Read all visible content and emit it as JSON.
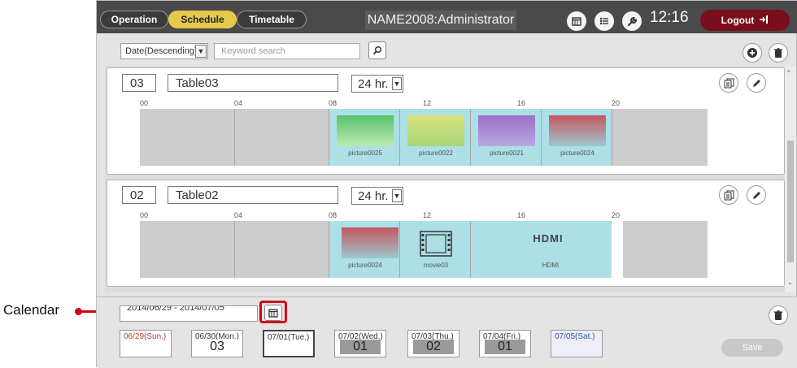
{
  "callout": {
    "label": "Calendar"
  },
  "nav": {
    "tabs": [
      {
        "label": "Operation",
        "active": false
      },
      {
        "label": "Schedule",
        "active": true
      },
      {
        "label": "Timetable",
        "active": false
      }
    ],
    "title": "NAME2008:Administrator",
    "icons": [
      "calendar-icon",
      "list-icon",
      "wrench-icon"
    ],
    "clock": "12:16",
    "logout_label": "Logout",
    "logout_icon": "logout-icon"
  },
  "toolbar": {
    "sort_value": "Date(Descending)",
    "search_placeholder": "Keyword search",
    "search_icon": "search-icon",
    "add_icon": "add-icon",
    "trash_icon": "trash-icon"
  },
  "tables": [
    {
      "number": "03",
      "name": "Table03",
      "hours": "24 hr.",
      "ticks": [
        "00",
        "04",
        "08",
        "12",
        "16",
        "20"
      ],
      "items": [
        {
          "caption": "picture0025",
          "color_top": "#58c26a",
          "color_bottom": "#bde8b4"
        },
        {
          "caption": "picture0022",
          "color_top": "#d8e27a",
          "color_bottom": "#a7d67a"
        },
        {
          "caption": "picture0021",
          "color_top": "#9b6fc9",
          "color_bottom": "#b9a7e0"
        },
        {
          "caption": "picture0024",
          "color_top": "#c4575f",
          "color_bottom": "#9fc7cf"
        }
      ]
    },
    {
      "number": "02",
      "name": "Table02",
      "hours": "24 hr.",
      "ticks": [
        "00",
        "04",
        "08",
        "12",
        "16",
        "20"
      ],
      "items": [
        {
          "caption": "picture0024",
          "color_top": "#c4575f",
          "color_bottom": "#9fc7cf"
        },
        {
          "caption": "movie03",
          "icon": "film-icon"
        },
        {
          "caption": "HDMI",
          "logo": "HDMI"
        }
      ]
    }
  ],
  "bottom": {
    "range": "2014/06/29 - 2014/07/05",
    "days": [
      {
        "label": "06/29(Sun.)",
        "value": "",
        "color": "#c0392b"
      },
      {
        "label": "06/30(Mon.)",
        "value": "03",
        "color": "#333333"
      },
      {
        "label": "07/01(Tue.)",
        "value": "",
        "color": "#333333"
      },
      {
        "label": "07/02(Wed.)",
        "value": "01",
        "color": "#333333"
      },
      {
        "label": "07/03(Thu.)",
        "value": "02",
        "color": "#333333"
      },
      {
        "label": "07/04(Fri.)",
        "value": "01",
        "color": "#333333"
      },
      {
        "label": "07/05(Sat.)",
        "value": "",
        "color": "#3355aa"
      }
    ],
    "save_label": "Save"
  }
}
